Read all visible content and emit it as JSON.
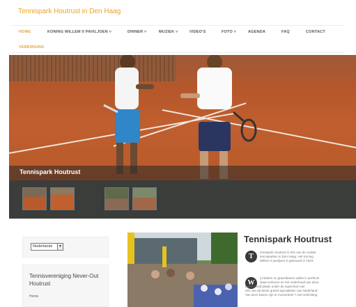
{
  "site": {
    "title": "Tennispark Houtrust in Den Haag"
  },
  "nav": {
    "items": [
      {
        "label": "HOME",
        "active": true
      },
      {
        "label": "KONING WILLEM II PAVILJOEN ˅"
      },
      {
        "label": "DINNER ˅"
      },
      {
        "label": "MUZIEK ˅"
      },
      {
        "label": "VIDEO'S"
      },
      {
        "label": "FOTO ˅"
      },
      {
        "label": "AGENDA"
      },
      {
        "label": "FAQ"
      },
      {
        "label": "CONTACT"
      }
    ],
    "second_row": "VERENIGING"
  },
  "hero": {
    "caption": "Tennispark Houtrust"
  },
  "sidebar": {
    "language": "Nederlands",
    "arrow": "▼",
    "club_title": "Tennisvereniging Never-Out Houtrust",
    "club_link": "Home"
  },
  "article": {
    "title": "Tennispark Houtrust",
    "p1_cap": "T",
    "p1_lines": [
      "ennispark Houtrust is één van de oudste",
      "tennisparken in Den Haag. Het Koning",
      "Willem II paviljoen is gebouwd in 1923."
    ],
    "p2_cap": "W",
    "p2_lines": [
      "ij hebben 11 gravelbanen welke in perfecte",
      "staat verkeren en het onderhoud van deze",
      "banen vindt plaats onder de supervisie van",
      "één van de beste gravel specialisten van Nederland.",
      "Van deze banen zijn er momenteel 7 met verlichting."
    ]
  },
  "colors": {
    "accent": "#e8a32a",
    "clay": "#b85a2c",
    "strip": "#3b3d3b"
  }
}
